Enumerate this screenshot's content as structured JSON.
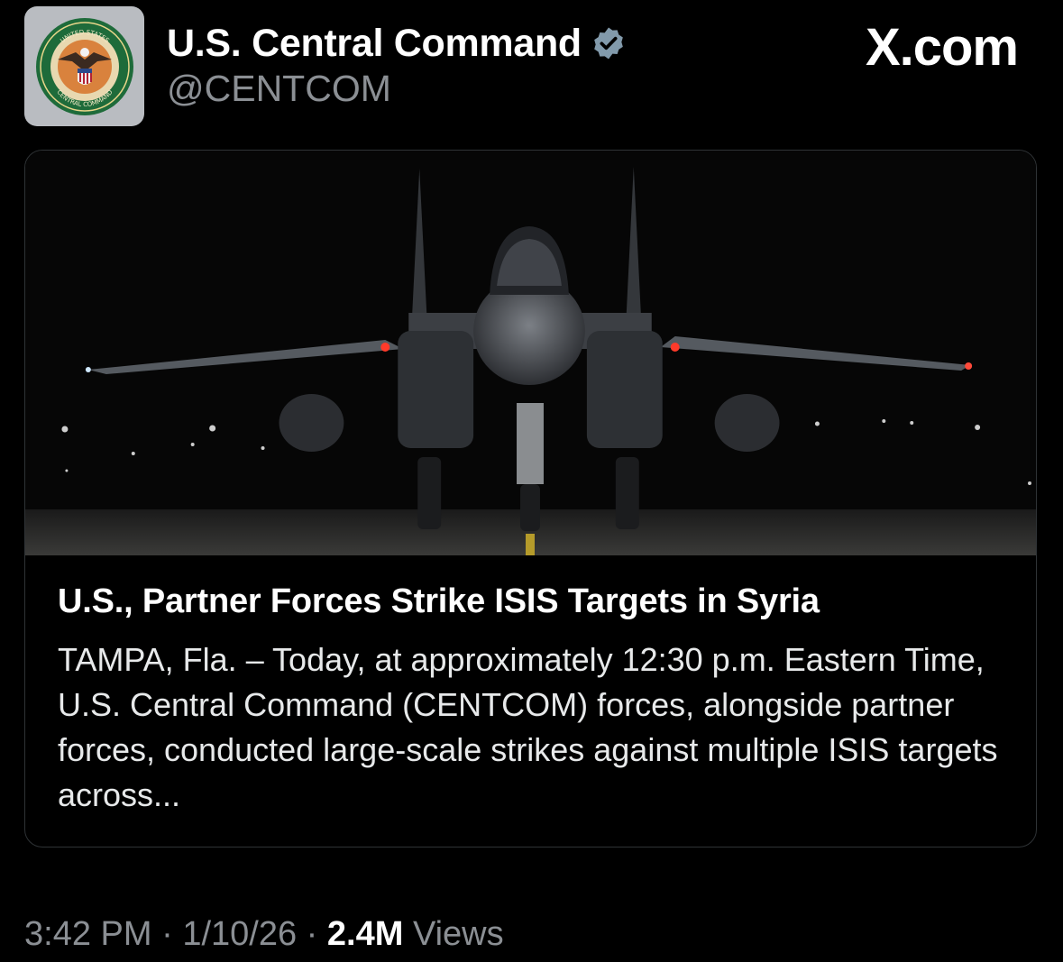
{
  "author": {
    "display_name": "U.S. Central Command",
    "handle": "@CENTCOM",
    "verified": true,
    "avatar": {
      "description_icon": "centcom-seal-icon",
      "top_text": "UNITED STATES",
      "bottom_text": "CENTRAL COMMAND"
    }
  },
  "brand_label": "X.com",
  "link_card": {
    "image_icon": "fighter-jet-photo",
    "title": "U.S., Partner Forces Strike ISIS Targets in Syria",
    "description": "TAMPA, Fla. – Today, at approximately 12:30 p.m. Eastern Time, U.S. Central Command (CENTCOM) forces, alongside partner forces, conducted large-scale strikes against multiple ISIS targets across..."
  },
  "meta": {
    "time": "3:42 PM",
    "separator": "·",
    "date": "1/10/26",
    "views_count": "2.4M",
    "views_label": "Views"
  },
  "colors": {
    "background": "#000000",
    "secondary_text": "#8b8f94",
    "verified_badge": "#829aab",
    "card_border": "#2f3336"
  }
}
